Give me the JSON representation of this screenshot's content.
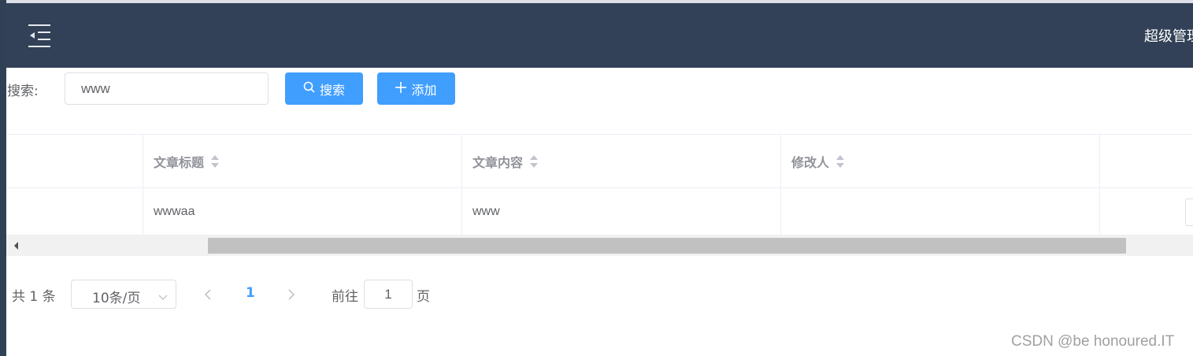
{
  "header": {
    "menu_icon": "hamburger-fold-icon",
    "user_label": "超级管理"
  },
  "search": {
    "label": "搜索:",
    "value": "www",
    "search_button": "搜索",
    "add_button": "添加",
    "search_icon": "search-icon",
    "add_icon": "plus-icon"
  },
  "table": {
    "columns": [
      "文章标题",
      "文章内容",
      "修改人"
    ],
    "rows": [
      [
        "wwwaa",
        "www",
        ""
      ]
    ]
  },
  "pagination": {
    "total": "共 1 条",
    "page_size": "10条/页",
    "current_page": "1",
    "goto_label": "前往",
    "goto_value": "1",
    "goto_suffix": "页"
  },
  "watermark": "CSDN @be honoured.IT",
  "colors": {
    "navbar": "#324157",
    "primary": "#409eff",
    "text": "#606266",
    "header_text": "#909399"
  }
}
